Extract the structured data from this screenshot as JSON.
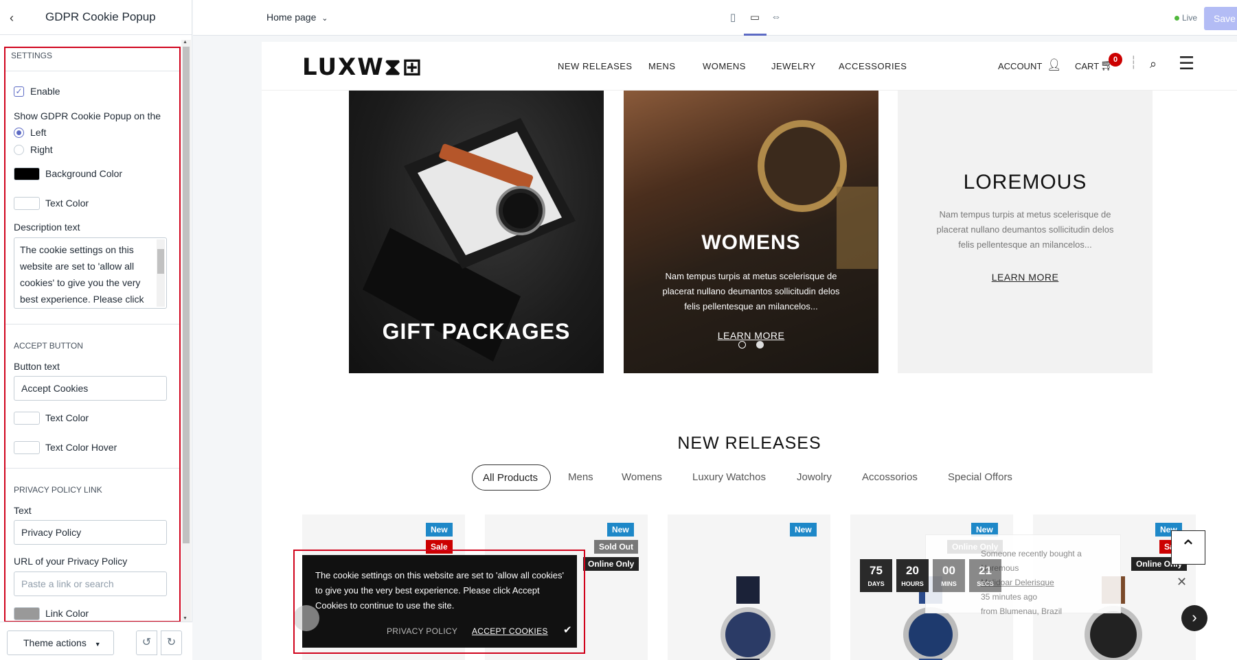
{
  "sidebar": {
    "title": "GDPR Cookie Popup",
    "settings": {
      "section_label": "SETTINGS",
      "enable_label": "Enable",
      "position_label": "Show GDPR Cookie Popup on the",
      "position_options": [
        "Left",
        "Right"
      ],
      "position_selected": "Left",
      "background_color_label": "Background Color",
      "background_color": "#000000",
      "text_color_label": "Text Color",
      "text_color": "#ffffff",
      "description_label": "Description text",
      "description_lines": [
        "The cookie settings on this",
        "website are set to 'allow all",
        "cookies' to give you the very",
        "best experience. Please click"
      ]
    },
    "accept_button": {
      "section_label": "ACCEPT BUTTON",
      "button_text_label": "Button text",
      "button_text_value": "Accept Cookies",
      "text_color_label": "Text Color",
      "text_color": "#ffffff",
      "text_color_hover_label": "Text Color Hover",
      "text_color_hover": "#ffffff"
    },
    "privacy_policy": {
      "section_label": "PRIVACY POLICY LINK",
      "text_label": "Text",
      "text_value": "Privacy Policy",
      "url_label": "URL of your Privacy Policy",
      "url_placeholder": "Paste a link or search",
      "link_color_label": "Link Color",
      "link_color": "#999999"
    },
    "footer": {
      "theme_actions_label": "Theme actions"
    }
  },
  "topbar": {
    "page_select": "Home page",
    "live_label": "Live",
    "save_label": "Save",
    "accent_color": "#5c6ac4"
  },
  "store": {
    "logo": "LUXW⧗⊞",
    "nav": [
      "NEW RELEASES",
      "MENS",
      "WOMENS",
      "JEWELRY",
      "ACCESSORIES"
    ],
    "account_label": "ACCOUNT",
    "cart_label": "CART",
    "cart_count": "0",
    "banners": [
      {
        "title": "GIFT PACKAGES"
      },
      {
        "title": "WOMENS",
        "description": [
          "Nam tempus turpis at metus scelerisque de",
          "placerat nullano deumantos sollicitudin delos",
          "felis pellentesque an milancelos..."
        ],
        "link": "LEARN MORE"
      },
      {
        "title": "LOREMOUS",
        "description": [
          "Nam tempus turpis at metus scelerisque de",
          "placerat nullano deumantos sollicitudin delos",
          "felis pellentesque an milancelos..."
        ],
        "link": "LEARN MORE"
      }
    ],
    "section_title": "NEW RELEASES",
    "tabs": [
      "All Products",
      "Mens",
      "Womens",
      "Luxury Watchos",
      "Jowolry",
      "Accossorios",
      "Special Offors"
    ],
    "product_badges": {
      "new": "New",
      "sale": "Sale",
      "sold_out": "Sold Out",
      "online_only": "Online Only"
    },
    "cookie_popup": {
      "text": "The cookie settings on this website are set to 'allow all cookies' to give you the very best experience. Please click Accept Cookies to continue to use the site.",
      "privacy_link": "PRIVACY POLICY",
      "accept_link": "ACCEPT COOKIES"
    },
    "countdown": [
      {
        "value": "75",
        "unit": "DAYS"
      },
      {
        "value": "20",
        "unit": "HOURS"
      },
      {
        "value": "00",
        "unit": "MINS"
      },
      {
        "value": "21",
        "unit": "SECS"
      }
    ],
    "notification": {
      "line1": "Someone recently bought a Noremous",
      "line2": "Malidoar Delerisque",
      "line3": "35 minutes ago",
      "line4": "from Blumenau, Brazil"
    }
  }
}
